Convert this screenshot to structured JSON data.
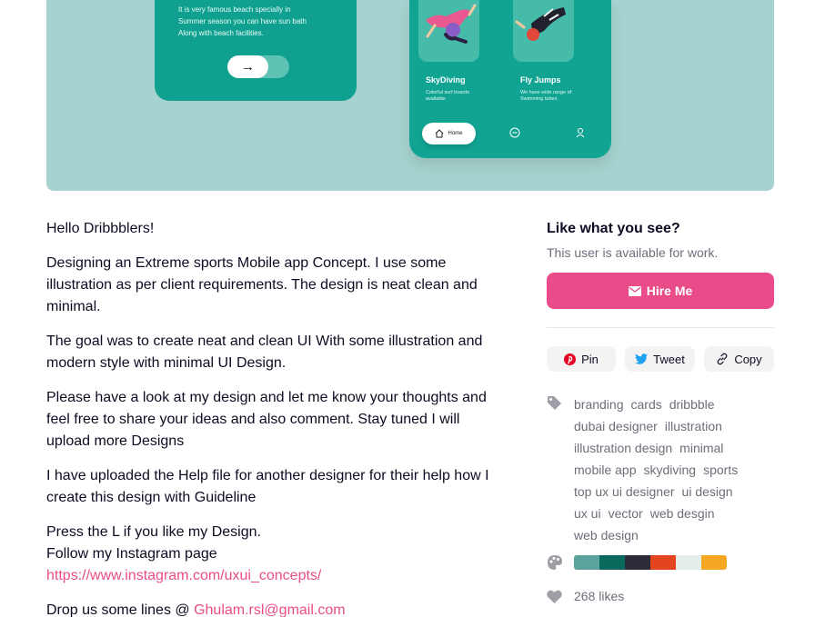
{
  "shot": {
    "card_description": [
      "It is very famous beach specially in",
      "Summer season you can have sun bath",
      "Along with beach facilities."
    ],
    "arrow_glyph": "→",
    "tiles": [
      {
        "name": "SkyDiving",
        "subtitle": [
          "Colorful surf boards",
          "available"
        ]
      },
      {
        "name": "Fly Jumps",
        "subtitle": [
          "We have wide range of",
          "Swimming tubes"
        ]
      }
    ],
    "nav": {
      "home_label": "Home",
      "chat_icon": "chat-bubble-icon",
      "profile_icon": "user-icon",
      "home_icon": "home-icon"
    }
  },
  "description": {
    "paragraphs": [
      "Hello Dribbblers!",
      "Designing an Extreme sports Mobile app Concept. I use some illustration as per client requirements. The design is neat clean and minimal.",
      "The goal was to create neat and clean UI With some illustration and modern style with minimal UI Design.",
      "Please have a look at my design and let me know your thoughts and feel free to share your ideas and also comment. Stay tuned I will upload more Designs",
      "I have uploaded the Help file for another designer for their help how I create this design with Guideline"
    ],
    "press_line": "Press the L if you like my Design.",
    "follow_line": "Follow my Instagram page",
    "instagram_link": "https://www.instagram.com/uxui_concepts/",
    "drop_prefix": "Drop us some lines @ ",
    "email_link": "Ghulam.rsl@gmail.com"
  },
  "sidebar": {
    "title": "Like what you see?",
    "availability": "This user is available for work.",
    "hire_label": "Hire Me",
    "share": {
      "pin": "Pin",
      "tweet": "Tweet",
      "copy": "Copy"
    },
    "tags": [
      "branding",
      "cards",
      "dribbble",
      "dubai designer",
      "illustration",
      "illustration design",
      "minimal",
      "mobile app",
      "skydiving",
      "sports",
      "top ux ui designer",
      "ui design",
      "ux ui",
      "vector",
      "web desgin",
      "web design"
    ],
    "palette": [
      "#5aa39c",
      "#086a5c",
      "#2c2b3a",
      "#e3461f",
      "#e6eeec",
      "#f5a623"
    ],
    "likes": "268 likes"
  },
  "colors": {
    "accent": "#ea4c89",
    "muted": "#6e6d7a",
    "teal_bg": "#a6d3cf",
    "teal_card": "#0fa08f"
  }
}
